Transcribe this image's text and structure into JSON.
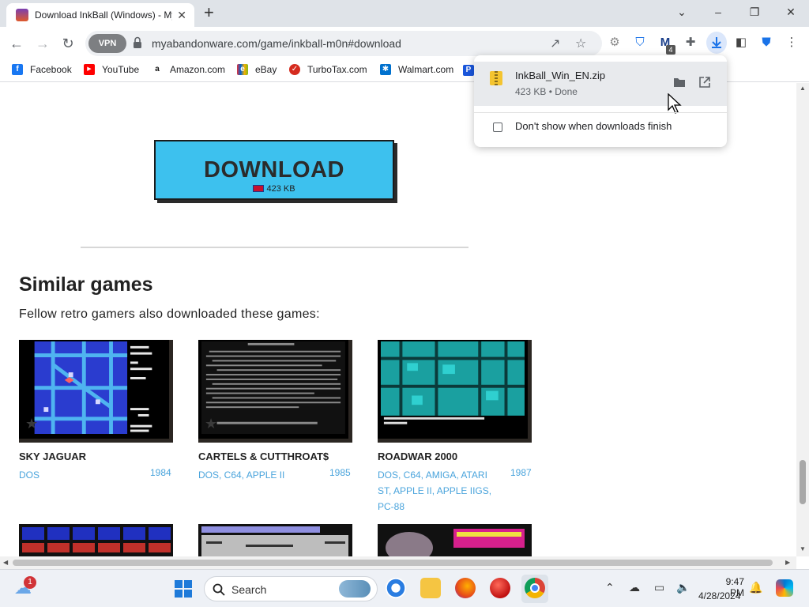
{
  "browser": {
    "tab": {
      "title": "Download InkBall (Windows) - My Abandonware",
      "favicon": "myabandonware-favicon"
    },
    "new_tab_symbol": "+",
    "window_controls": {
      "minimize": "–",
      "restore": "❐",
      "close": "✕",
      "tabsearch": "⌄"
    },
    "url": "myabandonware.com/game/inkball-m0n#download",
    "vpn_label": "VPN",
    "extension_badge": "4"
  },
  "bookmarks": [
    {
      "label": "Facebook",
      "icon": "facebook-icon",
      "color": "#1877f2",
      "glyph": "f"
    },
    {
      "label": "YouTube",
      "icon": "youtube-icon",
      "color": "#ff0000",
      "glyph": "▶"
    },
    {
      "label": "Amazon.com",
      "icon": "amazon-icon",
      "color": "#111111",
      "glyph": "a"
    },
    {
      "label": "eBay",
      "icon": "ebay-icon",
      "color": "#e53238",
      "glyph": "e"
    },
    {
      "label": "TurboTax.com",
      "icon": "turbotax-icon",
      "color": "#d52b1e",
      "glyph": "✓"
    },
    {
      "label": "Walmart.com",
      "icon": "walmart-icon",
      "color": "#0071ce",
      "glyph": "✱"
    }
  ],
  "download_button": {
    "label": "DOWNLOAD",
    "size": "423 KB"
  },
  "similar": {
    "heading": "Similar games",
    "subheading": "Fellow retro gamers also downloaded these games:",
    "games": [
      {
        "title": "SKY JAGUAR",
        "platforms": "DOS",
        "year": "1984"
      },
      {
        "title": "CARTELS & CUTTHROAT$",
        "platforms": "DOS, C64, APPLE II",
        "year": "1985"
      },
      {
        "title": "ROADWAR 2000",
        "platforms": "DOS, C64, AMIGA, ATARI ST, APPLE II, APPLE IIGS, PC-88",
        "year": "1987"
      }
    ]
  },
  "download_bubble": {
    "file_name": "InkBall_Win_EN.zip",
    "status": "423 KB • Done",
    "checkbox_label": "Don't show when downloads finish"
  },
  "taskbar": {
    "search_label": "Search",
    "time": "9:47 PM",
    "date": "4/28/2024",
    "weather_badge": "1"
  },
  "colors": {
    "download_button": "#3dc1ee",
    "link": "#4aa4dc",
    "accent": "#1a73e8"
  }
}
